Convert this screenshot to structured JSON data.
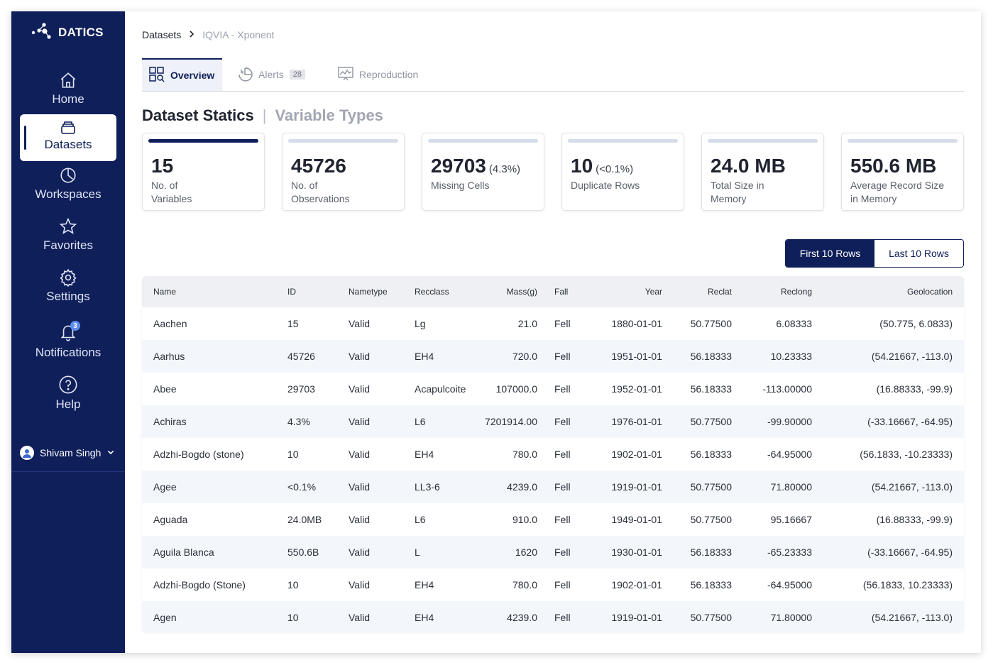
{
  "brand": {
    "name": "DATICS"
  },
  "sidebar": {
    "items": [
      {
        "label": "Home",
        "icon": "home-icon"
      },
      {
        "label": "Datasets",
        "icon": "datasets-icon",
        "active": true
      },
      {
        "label": "Workspaces",
        "icon": "workspaces-icon"
      },
      {
        "label": "Favorites",
        "icon": "star-icon"
      },
      {
        "label": "Settings",
        "icon": "gear-icon"
      },
      {
        "label": "Notifications",
        "icon": "bell-icon",
        "badge": "3"
      },
      {
        "label": "Help",
        "icon": "help-icon"
      }
    ],
    "user": {
      "name": "Shivam Singh"
    }
  },
  "breadcrumb": {
    "root": "Datasets",
    "current": "IQVIA - Xponent"
  },
  "tabs": [
    {
      "label": "Overview",
      "active": true
    },
    {
      "label": "Alerts",
      "count": "28"
    },
    {
      "label": "Reproduction"
    }
  ],
  "section": {
    "title": "Dataset Statics",
    "alt": "Variable Types"
  },
  "stats": [
    {
      "value": "15",
      "sub": "",
      "caption": "No. of Variables"
    },
    {
      "value": "45726",
      "sub": "",
      "caption": "No. of Observations"
    },
    {
      "value": "29703",
      "sub": "(4.3%)",
      "caption": "Missing Cells"
    },
    {
      "value": "10",
      "sub": "(<0.1%)",
      "caption": "Duplicate Rows"
    },
    {
      "value": "24.0 MB",
      "sub": "",
      "caption": "Total Size in Memory"
    },
    {
      "value": "550.6 MB",
      "sub": "",
      "caption": "Average Record Size in Memory"
    }
  ],
  "row_toggle": {
    "first": "First 10 Rows",
    "last": "Last 10 Rows",
    "selected": "first"
  },
  "table": {
    "columns": [
      "Name",
      "ID",
      "Nametype",
      "Recclass",
      "Mass(g)",
      "Fall",
      "Year",
      "Reclat",
      "Reclong",
      "Geolocation"
    ],
    "rows": [
      [
        "Aachen",
        "15",
        "Valid",
        "Lg",
        "21.0",
        "Fell",
        "1880-01-01",
        "50.77500",
        "6.08333",
        "(50.775, 6.0833)"
      ],
      [
        "Aarhus",
        "45726",
        "Valid",
        "EH4",
        "720.0",
        "Fell",
        "1951-01-01",
        "56.18333",
        "10.23333",
        "(54.21667, -113.0)"
      ],
      [
        "Abee",
        "29703",
        "Valid",
        "Acapulcoite",
        "107000.0",
        "Fell",
        "1952-01-01",
        "56.18333",
        "-113.00000",
        "(16.88333, -99.9)"
      ],
      [
        "Achiras",
        "4.3%",
        "Valid",
        "L6",
        "7201914.00",
        "Fell",
        "1976-01-01",
        "50.77500",
        "-99.90000",
        "(-33.16667, -64.95)"
      ],
      [
        "Adzhi-Bogdo (stone)",
        "10",
        "Valid",
        "EH4",
        "780.0",
        "Fell",
        "1902-01-01",
        "56.18333",
        "-64.95000",
        "(56.1833, -10.23333)"
      ],
      [
        "Agee",
        "<0.1%",
        "Valid",
        "LL3-6",
        "4239.0",
        "Fell",
        "1919-01-01",
        "50.77500",
        "71.80000",
        "(54.21667, -113.0)"
      ],
      [
        "Aguada",
        "24.0MB",
        "Valid",
        "L6",
        "910.0",
        "Fell",
        "1949-01-01",
        "50.77500",
        "95.16667",
        "(16.88333, -99.9)"
      ],
      [
        "Aguila Blanca",
        "550.6B",
        "Valid",
        "L",
        "1620",
        "Fell",
        "1930-01-01",
        "56.18333",
        "-65.23333",
        "(-33.16667, -64.95)"
      ],
      [
        "Adzhi-Bogdo (Stone)",
        "10",
        "Valid",
        "EH4",
        "780.0",
        "Fell",
        "1902-01-01",
        "56.18333",
        "-64.95000",
        "(56.1833, 10.23333)"
      ],
      [
        "Agen",
        "10",
        "Valid",
        "EH4",
        "4239.0",
        "Fell",
        "1919-01-01",
        "50.77500",
        "71.80000",
        "(54.21667, -113.0)"
      ]
    ]
  },
  "colors": {
    "primary": "#0f1f5a",
    "row_alt": "#f3f6fb",
    "header_bg": "#eef0f3"
  }
}
